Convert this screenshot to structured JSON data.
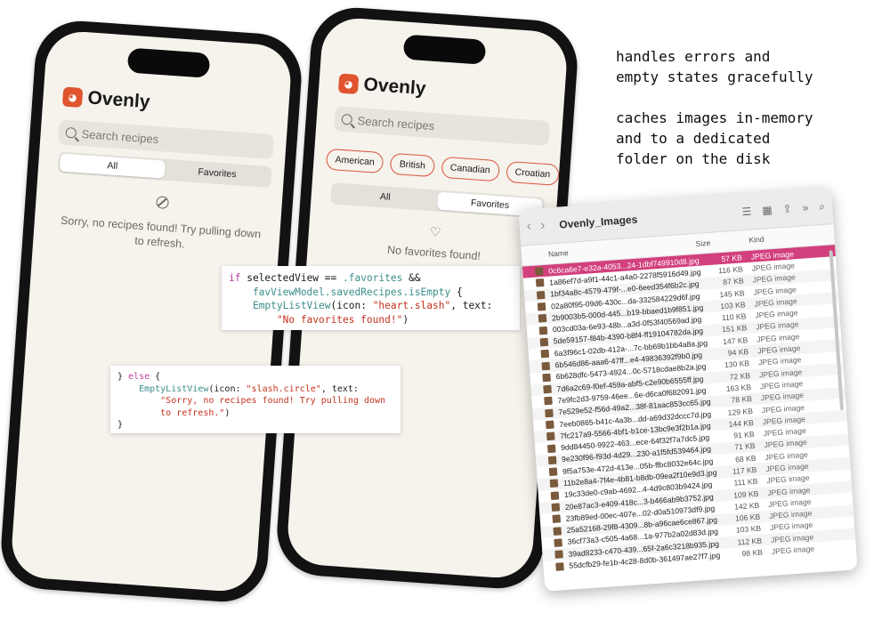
{
  "phone1": {
    "brand": "Ovenly",
    "search_placeholder": "Search recipes",
    "tabs": [
      "All",
      "Favorites"
    ],
    "active_tab": "All",
    "empty_icon": "slash-circle-icon",
    "empty_text": "Sorry, no recipes found! Try pulling down to refresh."
  },
  "phone2": {
    "brand": "Ovenly",
    "search_placeholder": "Search recipes",
    "chips": [
      "American",
      "British",
      "Canadian",
      "Croatian"
    ],
    "tabs": [
      "All",
      "Favorites"
    ],
    "active_tab": "Favorites",
    "empty_icon": "heart-slash-icon",
    "empty_text": "No favorites found!"
  },
  "code1": {
    "l1_kw": "if",
    "l1_a": " selectedView == ",
    "l1_b": ".favorites",
    "l1_c": " &&",
    "l2_a": "    favViewModel",
    "l2_b": ".savedRecipes.isEmpty",
    "l2_c": " {",
    "l3_a": "    EmptyListView",
    "l3_b": "(icon: ",
    "l3_c": "\"heart.slash\"",
    "l3_d": ", text:",
    "l4": "        \"No favorites found!\"",
    "l4_end": ")"
  },
  "code2": {
    "l1_a": "} ",
    "l1_kw": "else",
    "l1_b": " {",
    "l2_a": "    EmptyListView",
    "l2_b": "(icon: ",
    "l2_c": "\"slash.circle\"",
    "l2_d": ", text:",
    "l3": "        \"Sorry, no recipes found! Try pulling down",
    "l4": "        to refresh.\"",
    "l4_end": ")",
    "l5": "}"
  },
  "annotation": {
    "text1": "handles errors and\nempty states gracefully",
    "text2": "caches images in-memory\nand to a dedicated\nfolder on the disk"
  },
  "finder": {
    "title": "Ovenly_Images",
    "columns": [
      "Name",
      "Size",
      "Kind"
    ],
    "rows": [
      {
        "name": "0c6ca6e7-e32a-4053...24-1dbf749910d8.jpg",
        "size": "57 KB",
        "kind": "JPEG image",
        "selected": true
      },
      {
        "name": "1a86ef7d-a9f1-44c1-a4a0-2278f5916d49.jpg",
        "size": "116 KB",
        "kind": "JPEG image"
      },
      {
        "name": "1bf34a8c-4579-479f-...e0-6eed354f6b2c.jpg",
        "size": "87 KB",
        "kind": "JPEG image"
      },
      {
        "name": "02a80f95-09d6-430c...da-332584229d6f.jpg",
        "size": "145 KB",
        "kind": "JPEG image"
      },
      {
        "name": "2b9003b5-000d-445...b19-bbaed1b9f851.jpg",
        "size": "103 KB",
        "kind": "JPEG image"
      },
      {
        "name": "003cd03a-6e93-48b...a3d-0f53f40569ad.jpg",
        "size": "110 KB",
        "kind": "JPEG image"
      },
      {
        "name": "5de59157-f84b-4390-b8f4-ff19104782da.jpg",
        "size": "151 KB",
        "kind": "JPEG image"
      },
      {
        "name": "6a3f96c1-02db-412a-...7c-bb69b1bb4a8a.jpg",
        "size": "147 KB",
        "kind": "JPEG image"
      },
      {
        "name": "6b546d86-aaa6-47ff...e4-49836392f9b0.jpg",
        "size": "94 KB",
        "kind": "JPEG image"
      },
      {
        "name": "6b628dfc-5473-4924...0c-5718cdae8b2a.jpg",
        "size": "130 KB",
        "kind": "JPEG image"
      },
      {
        "name": "7d6a2c69-f0ef-459a-abf5-c2e90b6555ff.jpg",
        "size": "72 KB",
        "kind": "JPEG image"
      },
      {
        "name": "7e9fc2d3-9759-46ee...6e-d6ca0f682091.jpg",
        "size": "163 KB",
        "kind": "JPEG image"
      },
      {
        "name": "7e529e52-f56d-49a2...38f-81aac853cc65.jpg",
        "size": "78 KB",
        "kind": "JPEG image"
      },
      {
        "name": "7eeb0865-b41c-4a3b...dd-a69d32dccc7d.jpg",
        "size": "129 KB",
        "kind": "JPEG image"
      },
      {
        "name": "7fc217a9-5566-4bf1-b1ce-13bc9e3f2b1a.jpg",
        "size": "144 KB",
        "kind": "JPEG image"
      },
      {
        "name": "9dd84450-9922-463...ece-64f32f7a7dc5.jpg",
        "size": "91 KB",
        "kind": "JPEG image"
      },
      {
        "name": "9e230f96-f93d-4d29...230-a1f5fd539464.jpg",
        "size": "71 KB",
        "kind": "JPEG image"
      },
      {
        "name": "9f5a753e-472d-413e...05b-ffbc8032e64c.jpg",
        "size": "68 KB",
        "kind": "JPEG image"
      },
      {
        "name": "11b2e8a4-7f4e-4b81-b8db-09ea2f10e9d3.jpg",
        "size": "117 KB",
        "kind": "JPEG image"
      },
      {
        "name": "19c33de0-c9ab-4692...4-4d9c803b9424.jpg",
        "size": "111 KB",
        "kind": "JPEG image"
      },
      {
        "name": "20e87ac3-e409-418c...3-b466ab9b3752.jpg",
        "size": "109 KB",
        "kind": "JPEG image"
      },
      {
        "name": "23fb89ed-00ec-407e...02-d0a510973df9.jpg",
        "size": "142 KB",
        "kind": "JPEG image"
      },
      {
        "name": "25a52168-29f8-4309...8b-a96cae6ce867.jpg",
        "size": "106 KB",
        "kind": "JPEG image"
      },
      {
        "name": "36cf73a3-c505-4a68...1a-977b2a02d83d.jpg",
        "size": "103 KB",
        "kind": "JPEG image"
      },
      {
        "name": "39ad8233-c470-439...65f-2a6c3218b935.jpg",
        "size": "112 KB",
        "kind": "JPEG image"
      },
      {
        "name": "55dcfb29-fe1b-4c28-8d0b-361497ae27f7.jpg",
        "size": "98 KB",
        "kind": "JPEG image"
      }
    ]
  }
}
